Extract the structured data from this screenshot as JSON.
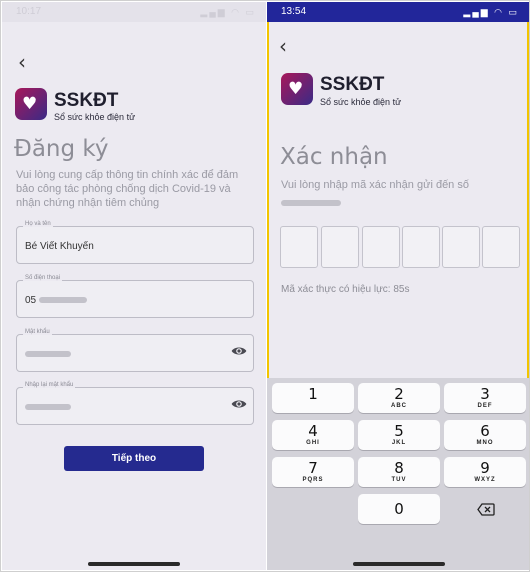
{
  "left": {
    "status_time": "10:17",
    "back_icon": "chevron-left-icon",
    "brand_name": "SSKĐT",
    "brand_subtitle": "Sổ sức khỏe điện tử",
    "title": "Đăng ký",
    "description": "Vui lòng cung cấp thông tin chính xác để đảm bảo công tác phòng chống dịch Covid-19 và nhận chứng nhận tiêm chủng",
    "fields": [
      {
        "label": "Họ và tên",
        "value": "Bé Viết Khuyến"
      },
      {
        "label": "Số điện thoại",
        "value": "05"
      },
      {
        "label": "Mật khẩu",
        "value": ""
      },
      {
        "label": "Nhập lại mật khẩu",
        "value": ""
      }
    ],
    "next_button": "Tiếp theo"
  },
  "right": {
    "status_time": "13:54",
    "back_icon": "chevron-left-icon",
    "brand_name": "SSKĐT",
    "brand_subtitle": "Sổ sức khỏe điện tử",
    "title": "Xác nhận",
    "instruction": "Vui lòng nhập mã xác nhận gửi đến số",
    "code_length": 6,
    "validity": "Mã xác thực có hiệu lực: 85s",
    "keys": [
      {
        "n": "1",
        "l": ""
      },
      {
        "n": "2",
        "l": "ABC"
      },
      {
        "n": "3",
        "l": "DEF"
      },
      {
        "n": "4",
        "l": "GHI"
      },
      {
        "n": "5",
        "l": "JKL"
      },
      {
        "n": "6",
        "l": "MNO"
      },
      {
        "n": "7",
        "l": "PQRS"
      },
      {
        "n": "8",
        "l": "TUV"
      },
      {
        "n": "9",
        "l": "WXYZ"
      },
      {
        "n": "0",
        "l": ""
      }
    ]
  },
  "colors": {
    "accent": "#252a8f",
    "highlight_border": "#f2c500"
  }
}
